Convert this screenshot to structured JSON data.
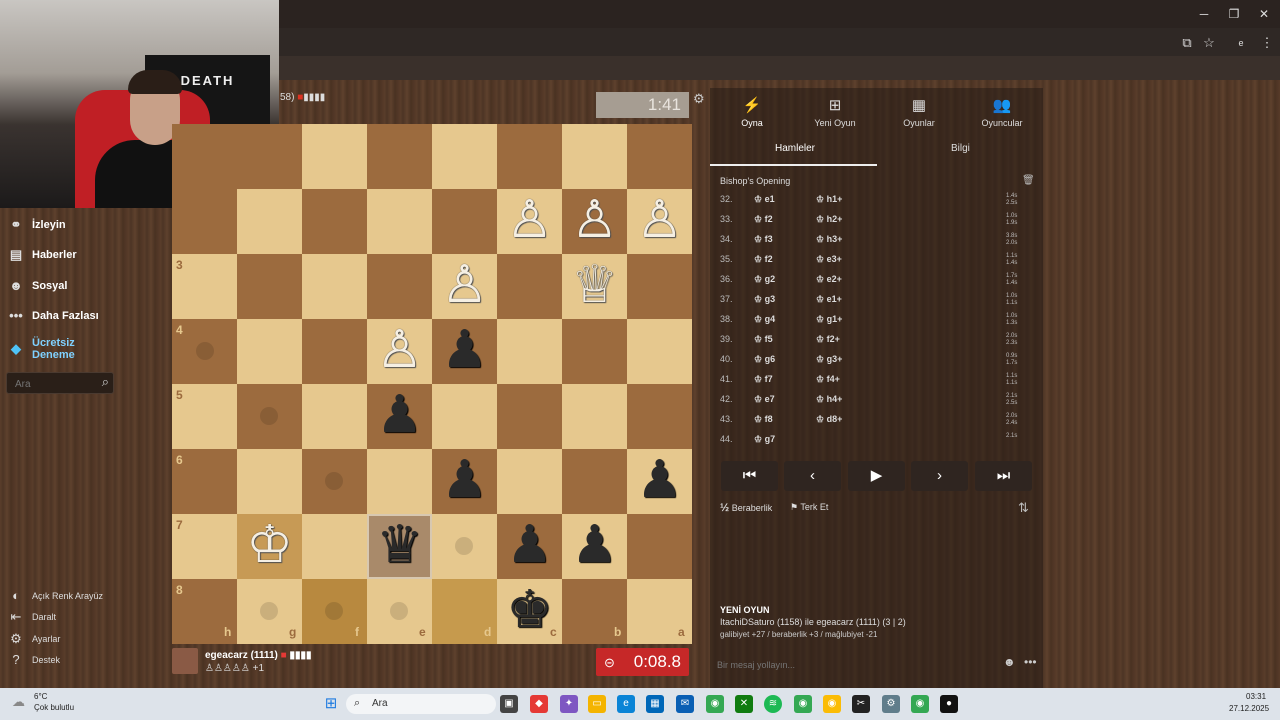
{
  "browser": {
    "window_controls": [
      "─",
      "❐",
      "✕"
    ],
    "profile_initial": "e"
  },
  "webcam": {
    "banner_text": "DEATH"
  },
  "sidebar": {
    "items": [
      {
        "label": "İzleyin",
        "icon": "binoculars-icon"
      },
      {
        "label": "Haberler",
        "icon": "newspaper-icon"
      },
      {
        "label": "Sosyal",
        "icon": "social-icon"
      },
      {
        "label": "Daha Fazlası",
        "icon": "dots-icon"
      },
      {
        "label": "Ücretsiz\nDeneme",
        "icon": "diamond-icon"
      }
    ],
    "search_placeholder": "Ara",
    "footer": [
      {
        "label": "Açık Renk Arayüz",
        "icon": "theme-icon"
      },
      {
        "label": "Daralt",
        "icon": "collapse-icon"
      },
      {
        "label": "Ayarlar",
        "icon": "gear-icon"
      },
      {
        "label": "Destek",
        "icon": "help-icon"
      }
    ]
  },
  "top_player": {
    "rating_text": "58)",
    "clock": "1:41"
  },
  "bottom_player": {
    "name": "egeacarz (1111)",
    "captured": "+1",
    "clock": "0:08.8"
  },
  "board": {
    "ranks": [
      "3",
      "4",
      "5",
      "6",
      "7",
      "8"
    ],
    "files": [
      "h",
      "g",
      "f",
      "e",
      "d",
      "c",
      "b",
      "a"
    ],
    "pieces": {
      "white_pawn": "♙",
      "white_queen": "♕",
      "white_king": "♔",
      "black_pawn": "♟",
      "black_queen": "♛",
      "black_king": "♚"
    }
  },
  "panel": {
    "tabs": [
      {
        "label": "Oyna",
        "icon": "lightning-icon"
      },
      {
        "label": "Yeni Oyun",
        "icon": "plus-icon"
      },
      {
        "label": "Oyunlar",
        "icon": "board-icon"
      },
      {
        "label": "Oyuncular",
        "icon": "players-icon"
      }
    ],
    "subtabs": [
      "Hamleler",
      "Bilgi"
    ],
    "opening": "Bishop's Opening",
    "moves": [
      {
        "n": "32.",
        "w": "e1",
        "b": "h1+",
        "t": [
          "1.4s",
          "2.5s"
        ]
      },
      {
        "n": "33.",
        "w": "f2",
        "b": "h2+",
        "t": [
          "1.0s",
          "1.9s"
        ]
      },
      {
        "n": "34.",
        "w": "f3",
        "b": "h3+",
        "t": [
          "3.8s",
          "2.0s"
        ]
      },
      {
        "n": "35.",
        "w": "f2",
        "b": "e3+",
        "t": [
          "1.1s",
          "1.4s"
        ]
      },
      {
        "n": "36.",
        "w": "g2",
        "b": "e2+",
        "t": [
          "1.7s",
          "1.4s"
        ]
      },
      {
        "n": "37.",
        "w": "g3",
        "b": "e1+",
        "t": [
          "1.0s",
          "1.1s"
        ]
      },
      {
        "n": "38.",
        "w": "g4",
        "b": "g1+",
        "t": [
          "1.0s",
          "1.3s"
        ]
      },
      {
        "n": "39.",
        "w": "f5",
        "b": "f2+",
        "t": [
          "2.0s",
          "2.3s"
        ]
      },
      {
        "n": "40.",
        "w": "g6",
        "b": "g3+",
        "t": [
          "0.9s",
          "1.7s"
        ]
      },
      {
        "n": "41.",
        "w": "f7",
        "b": "f4+",
        "t": [
          "1.1s",
          "1.1s"
        ]
      },
      {
        "n": "42.",
        "w": "e7",
        "b": "h4+",
        "t": [
          "2.1s",
          "2.5s"
        ]
      },
      {
        "n": "43.",
        "w": "f8",
        "b": "d8+",
        "t": [
          "2.0s",
          "2.4s"
        ]
      },
      {
        "n": "44.",
        "w": "g7",
        "b": "",
        "t": [
          "2.1s",
          ""
        ]
      }
    ],
    "controls": [
      "⏮",
      "‹",
      "▶",
      "›",
      "⏭"
    ],
    "draw_label": "Beraberlik",
    "draw_icon": "½",
    "resign_label": "Terk Et",
    "newgame": {
      "title": "YENİ OYUN",
      "line1": "ItachiDSaturo (1158) ile egeacarz (1111) (3 | 2)",
      "line2": "galibiyet +27 / beraberlik +3 / mağlubiyet -21"
    },
    "chat_placeholder": "Bir mesaj yollayın..."
  },
  "taskbar": {
    "weather_temp": "6°C",
    "weather_desc": "Çok bulutlu",
    "search_label": "Ara",
    "time": "03:31",
    "date": "27.12.2025"
  }
}
